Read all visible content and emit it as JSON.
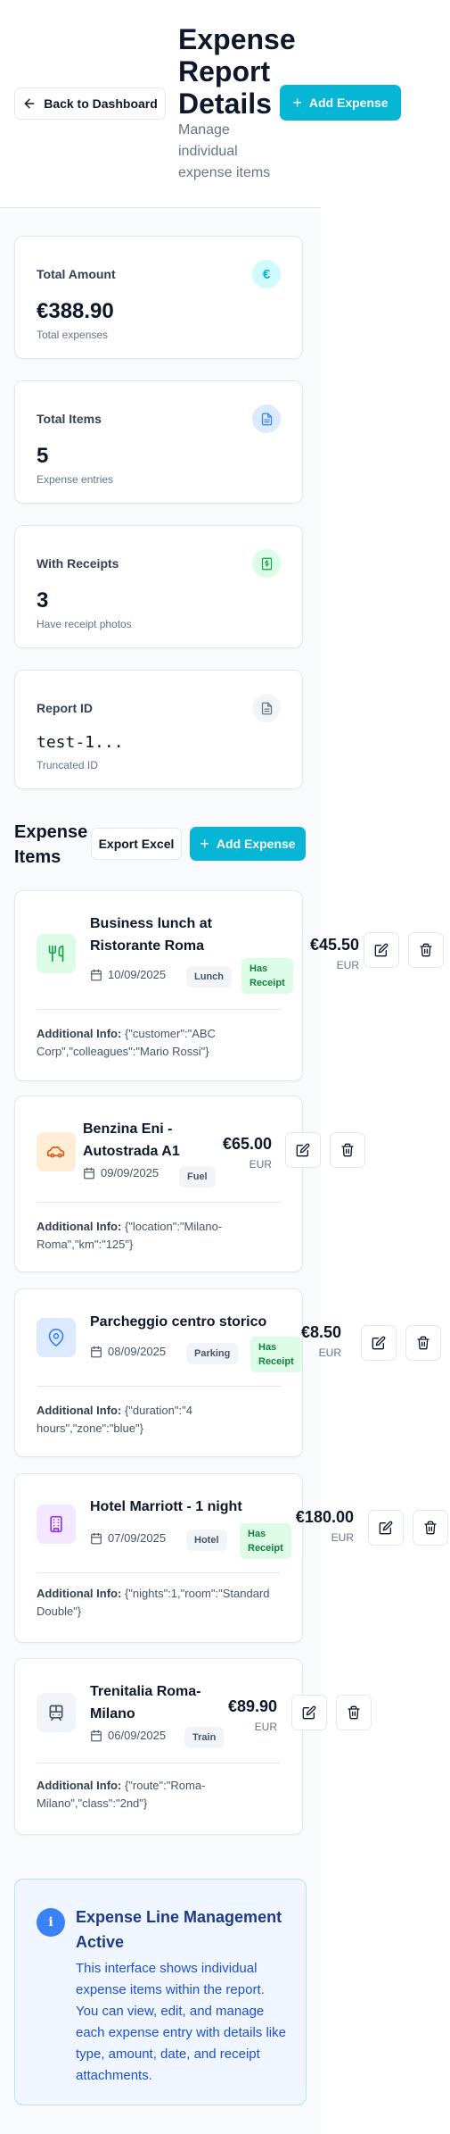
{
  "header": {
    "back_label": "Back to Dashboard",
    "title": "Expense Report Details",
    "subtitle": "Manage individual expense items",
    "add_label": "Add Expense"
  },
  "stats": [
    {
      "label": "Total Amount",
      "value": "€388.90",
      "sub": "Total expenses",
      "icon": "euro-icon",
      "color": "#06b6d4"
    },
    {
      "label": "Total Items",
      "value": "5",
      "sub": "Expense entries",
      "icon": "document-icon",
      "color": "#3b82f6"
    },
    {
      "label": "With Receipts",
      "value": "3",
      "sub": "Have receipt photos",
      "icon": "receipt-icon",
      "color": "#16a34a"
    },
    {
      "label": "Report ID",
      "value": "test-1...",
      "sub": "Truncated ID",
      "icon": "document-icon",
      "color": "#64748b"
    }
  ],
  "items_section": {
    "title": "Expense Items",
    "export_label": "Export Excel",
    "add_label": "Add Expense"
  },
  "items": [
    {
      "title": "Business lunch at Ristorante Roma",
      "date": "10/09/2025",
      "type": "Lunch",
      "receipt": "Has Receipt",
      "amount": "€45.50",
      "currency": "EUR",
      "info_label": "Additional Info:",
      "info": "{\"customer\":\"ABC Corp\",\"colleagues\":\"Mario Rossi\"}"
    },
    {
      "title": "Benzina Eni - Autostrada A1",
      "date": "09/09/2025",
      "type": "Fuel",
      "receipt": "",
      "amount": "€65.00",
      "currency": "EUR",
      "info_label": "Additional Info:",
      "info": "{\"location\":\"Milano-Roma\",\"km\":\"125\"}"
    },
    {
      "title": "Parcheggio centro storico",
      "date": "08/09/2025",
      "type": "Parking",
      "receipt": "Has Receipt",
      "amount": "€8.50",
      "currency": "EUR",
      "info_label": "Additional Info:",
      "info": "{\"duration\":\"4 hours\",\"zone\":\"blue\"}"
    },
    {
      "title": "Hotel Marriott - 1 night",
      "date": "07/09/2025",
      "type": "Hotel",
      "receipt": "Has Receipt",
      "amount": "€180.00",
      "currency": "EUR",
      "info_label": "Additional Info:",
      "info": "{\"nights\":1,\"room\":\"Standard Double\"}"
    },
    {
      "title": "Trenitalia Roma-Milano",
      "date": "06/09/2025",
      "type": "Train",
      "receipt": "",
      "amount": "€89.90",
      "currency": "EUR",
      "info_label": "Additional Info:",
      "info": "{\"route\":\"Roma-Milano\",\"class\":\"2nd\"}"
    }
  ],
  "info_box": {
    "title": "Expense Line Management Active",
    "text": "This interface shows individual expense items within the report. You can view, edit, and manage each expense entry with details like type, amount, date, and receipt attachments."
  },
  "colors": {
    "accent": "#06b6d4",
    "heading": "#0f172a",
    "receipt_badge": "#dcfce7",
    "info_bg": "#eff6ff",
    "info_text": "#1d4ed8"
  }
}
